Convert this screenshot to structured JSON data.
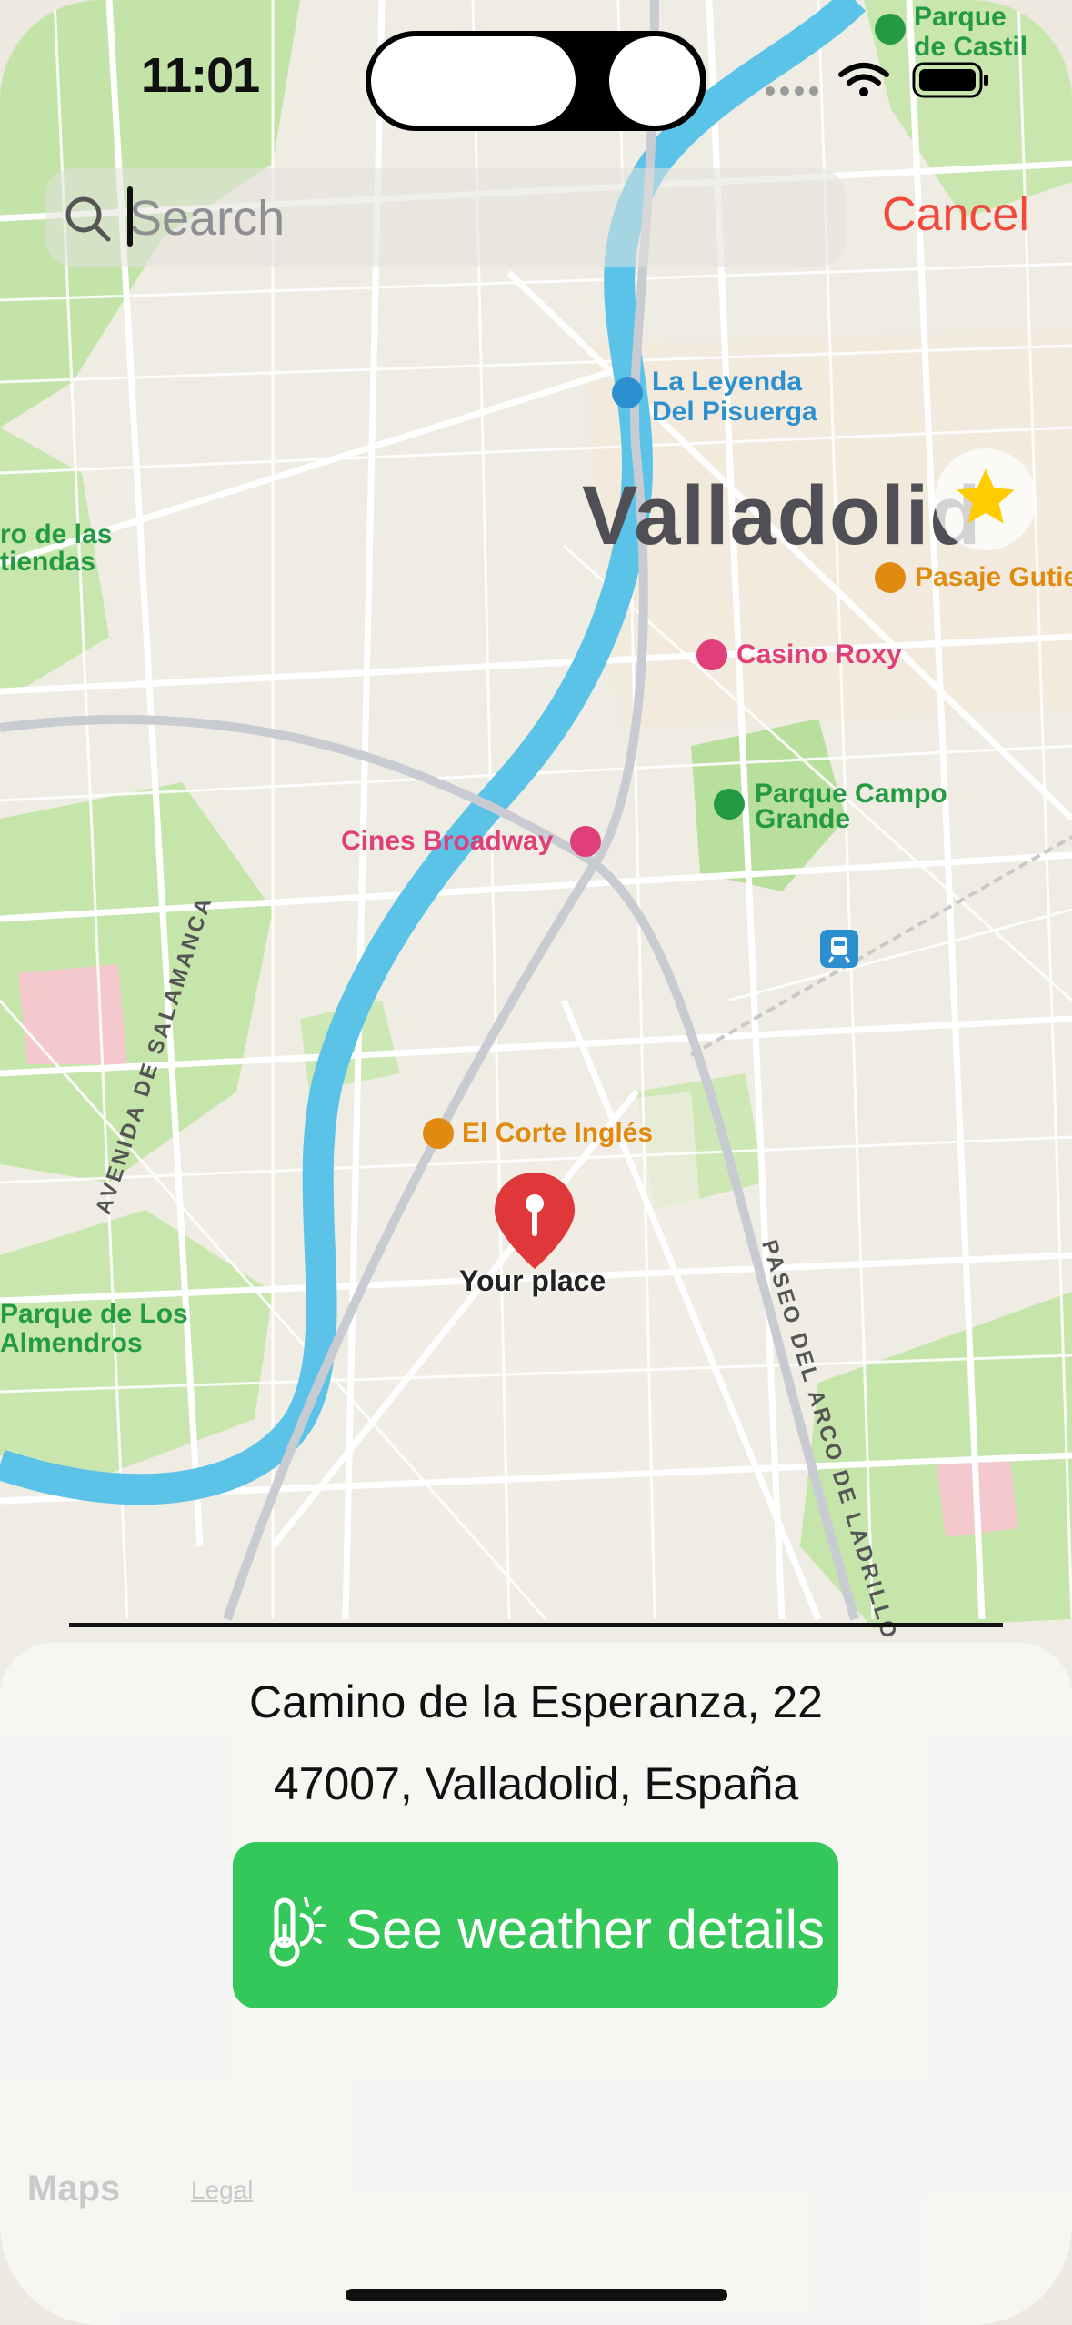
{
  "status_bar": {
    "time": "11:01",
    "icons": [
      "wifi-icon",
      "battery-icon"
    ]
  },
  "search": {
    "placeholder": "Search",
    "value": "",
    "cancel_label": "Cancel"
  },
  "map": {
    "city_label": "Valladolid",
    "pois": {
      "leyenda_line1": "La Leyenda",
      "leyenda_line2": "Del Pisuerga",
      "casino": "Casino Roxy",
      "pasaje": "Pasaje Gutie",
      "campo_line1": "Parque Campo",
      "campo_line2": "Grande",
      "cines": "Cines Broadway",
      "corte": "El Corte Inglés",
      "castilla_line1": "Parque",
      "castilla_line2": "de Castil",
      "huertas_line1": "ro de las",
      "huertas_line2": "tiendas",
      "almendros_line1": "Parque de Los",
      "almendros_line2": "Almendros"
    },
    "streets": {
      "salamanca": "AVENIDA DE SALAMANCA",
      "paseo_arco": "PASEO DEL ARCO DE LADRILLO"
    },
    "pin_label": "Your place"
  },
  "sheet": {
    "address_line1": "Camino de la Esperanza, 22",
    "address_line2": "47007, Valladolid, España",
    "weather_button_label": "See weather details",
    "maps_brand": "Maps",
    "legal_label": "Legal"
  },
  "colors": {
    "accent_green": "#34c759",
    "cancel_red": "#f2493b",
    "river": "#5cc3e8",
    "park": "#bfe3a2",
    "pin_red": "#e0383a",
    "favorite_star": "#ffcc00"
  }
}
